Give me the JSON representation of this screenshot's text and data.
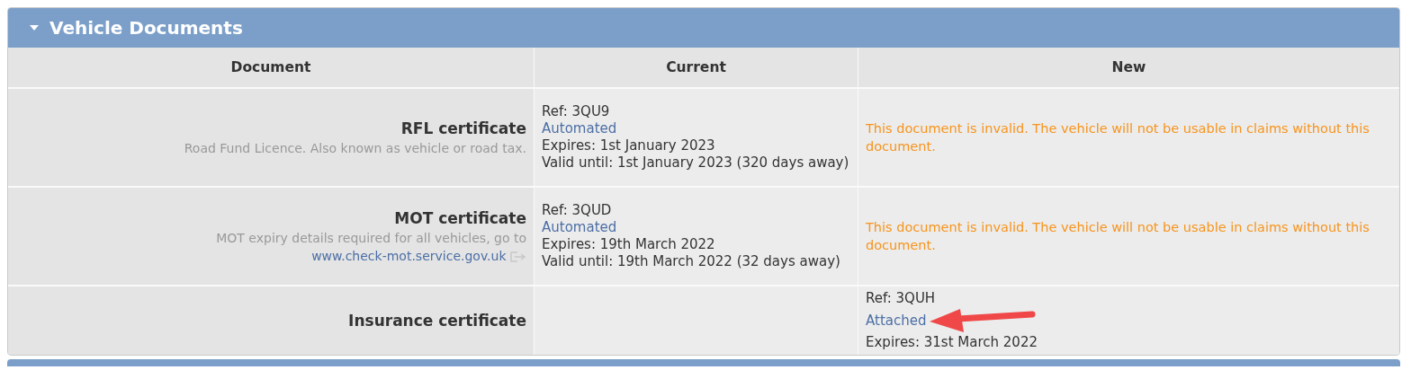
{
  "panel": {
    "title": "Vehicle Documents",
    "expanded": true
  },
  "columns": [
    "Document",
    "Current",
    "New"
  ],
  "rows": [
    {
      "name": "RFL certificate",
      "description": "Road Fund Licence. Also known as vehicle or road tax.",
      "current": {
        "kind": "details",
        "ref": "Ref: 3QU9",
        "source": "Automated",
        "expires": "Expires: 1st January 2023",
        "valid_until": "Valid until: 1st January 2023 (320 days away)"
      },
      "new": {
        "kind": "warning",
        "text": "This document is invalid. The vehicle will not be usable in claims without this document."
      }
    },
    {
      "name": "MOT certificate",
      "description": "MOT expiry details required for all vehicles, go to",
      "link": "www.check-mot.service.gov.uk",
      "current": {
        "kind": "details",
        "ref": "Ref: 3QUD",
        "source": "Automated",
        "expires": "Expires: 19th March 2022",
        "valid_until": "Valid until: 19th March 2022 (32 days away)"
      },
      "new": {
        "kind": "warning",
        "text": "This document is invalid. The vehicle will not be usable in claims without this document."
      }
    },
    {
      "name": "Insurance certificate",
      "current": {
        "kind": "empty"
      },
      "new": {
        "kind": "details",
        "ref": "Ref: 3QUH",
        "source": "Attached",
        "expires": "Expires: 31st March 2022",
        "pointer": true
      }
    }
  ]
}
